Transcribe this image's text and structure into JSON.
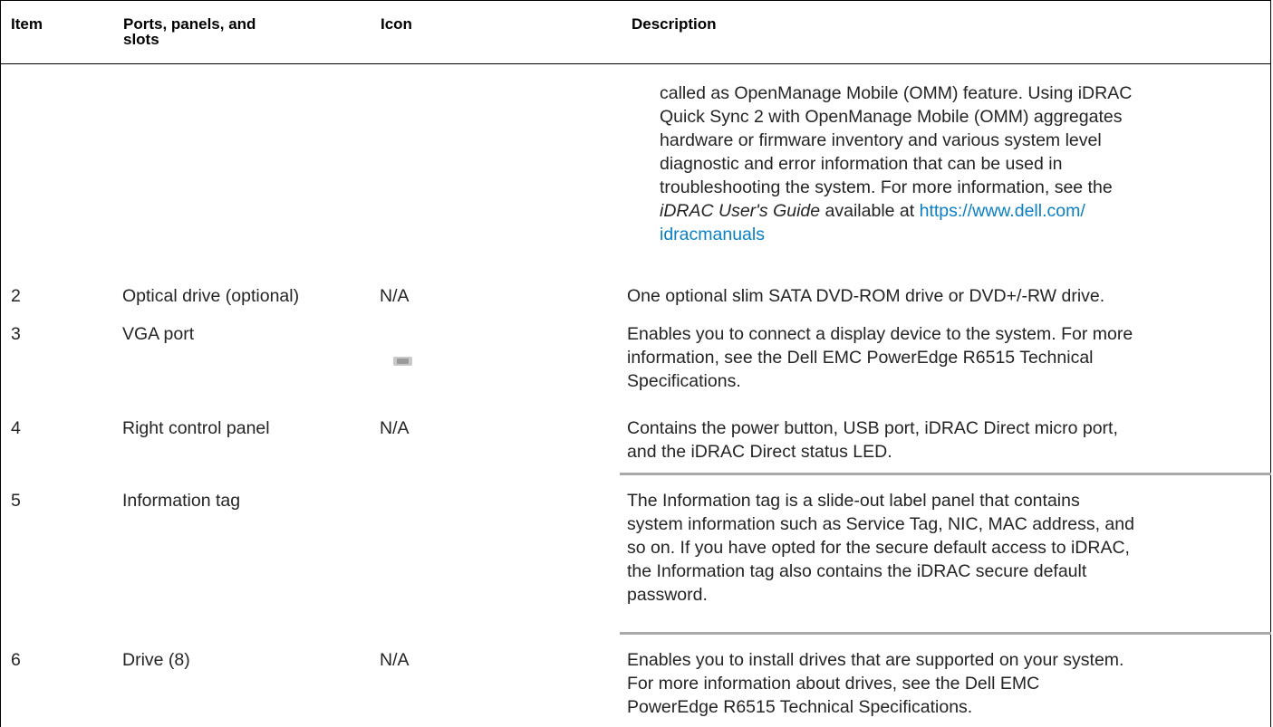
{
  "header": {
    "item": "Item",
    "ports_line1": "Ports, panels, and",
    "ports_line2": "slots",
    "icon": "Icon",
    "description": "Description"
  },
  "continued_description": {
    "line1": "called as OpenManage Mobile (OMM) feature. Using iDRAC",
    "line2": "Quick Sync 2 with OpenManage Mobile (OMM) aggregates",
    "line3": "hardware or firmware inventory and various system level",
    "line4": "diagnostic and error information that can be used in",
    "line5": "troubleshooting the system. For more information, see the",
    "guide_italic": "iDRAC User's Guide",
    "available_at": " available at ",
    "link_part1": "https://www.dell.com/",
    "link_part2": "idracmanuals"
  },
  "rows": [
    {
      "item": "2",
      "name": "Optical drive (optional)",
      "icon": "N/A",
      "description": [
        "One optional slim SATA DVD-ROM drive or DVD+/-RW drive."
      ]
    },
    {
      "item": "3",
      "name": "VGA port",
      "icon_name": "vga-port-icon",
      "description": [
        "Enables you to connect a display device to the system. For more",
        "information, see the Dell EMC PowerEdge R6515 Technical",
        "Specifications."
      ]
    },
    {
      "item": "4",
      "name": "Right control panel",
      "icon": "N/A",
      "description": [
        "Contains the power button, USB port, iDRAC Direct micro port,",
        "and the iDRAC Direct status LED."
      ]
    },
    {
      "item": "5",
      "name": "Information tag",
      "icon": "",
      "description": [
        "The Information tag is a slide-out label panel that contains",
        "system information such as Service Tag, NIC, MAC address, and",
        "so on. If you have opted for the secure default access to iDRAC,",
        "the Information tag also contains the iDRAC secure default",
        "password."
      ]
    },
    {
      "item": "6",
      "name": "Drive (8)",
      "icon": "N/A",
      "description": [
        "Enables you to install drives that are supported on your system.",
        "For more information about drives, see the Dell EMC",
        "PowerEdge R6515 Technical Specifications."
      ]
    }
  ],
  "colors": {
    "link": "#0a7fc4",
    "text": "#242424",
    "separator": "#a8a8a8"
  }
}
